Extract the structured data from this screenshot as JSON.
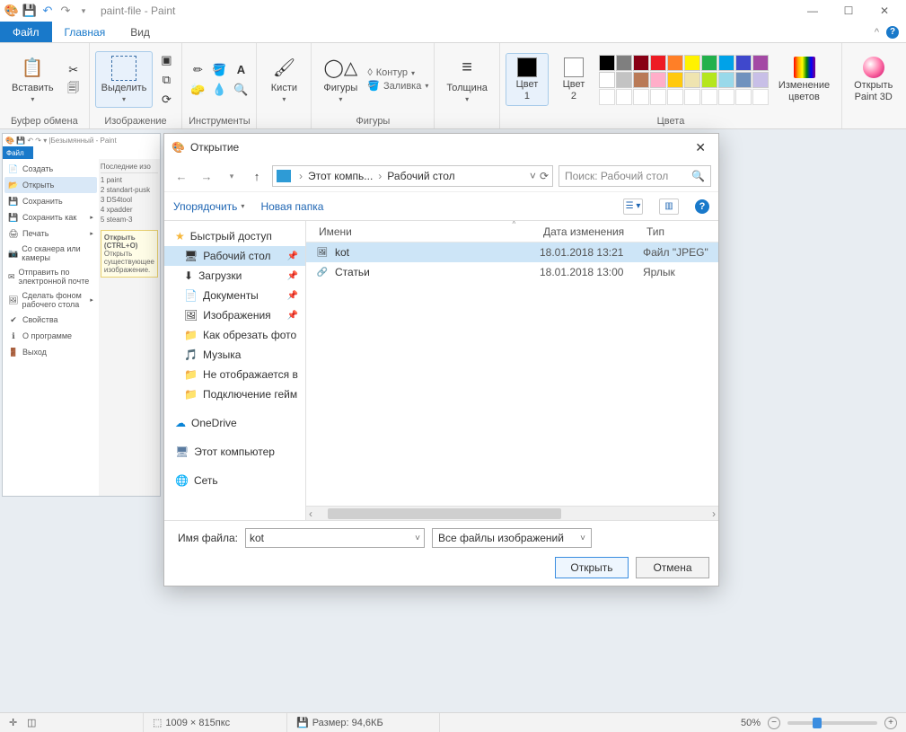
{
  "title": "paint-file - Paint",
  "tabs": {
    "file": "Файл",
    "home": "Главная",
    "view": "Вид"
  },
  "ribbon": {
    "clipboard": {
      "paste": "Вставить",
      "label": "Буфер обмена"
    },
    "image": {
      "select": "Выделить",
      "label": "Изображение"
    },
    "tools": {
      "label": "Инструменты"
    },
    "brushes": {
      "label": "Кисти"
    },
    "shapes": {
      "title": "Фигуры",
      "outline": "Контур",
      "fill": "Заливка",
      "label": "Фигуры"
    },
    "size": {
      "label": "Толщина"
    },
    "color1": "Цвет\n1",
    "color2": "Цвет\n2",
    "colors_label": "Цвета",
    "edit_colors": "Изменение\nцветов",
    "paint3d": "Открыть\nPaint 3D"
  },
  "palette": [
    "#000000",
    "#7f7f7f",
    "#880015",
    "#ed1c24",
    "#ff7f27",
    "#fff200",
    "#22b14c",
    "#00a2e8",
    "#3f48cc",
    "#a349a4",
    "#ffffff",
    "#c3c3c3",
    "#b97a57",
    "#ffaec9",
    "#ffc90e",
    "#efe4b0",
    "#b5e61d",
    "#99d9ea",
    "#7092be",
    "#c8bfe7"
  ],
  "subpaint": {
    "title": "Безымянный - Paint",
    "filetab": "Файл",
    "recent_header": "Последние изо",
    "recent": [
      "1 paint",
      "2 standart-pusk",
      "3 DS4tool",
      "4 xpadder",
      "5 steam-3"
    ],
    "tooltip_title": "Открыть (CTRL+O)",
    "tooltip_body": "Открыть существующее изображение.",
    "menu": [
      {
        "icon": "📄",
        "label": "Создать"
      },
      {
        "icon": "📂",
        "label": "Открыть"
      },
      {
        "icon": "💾",
        "label": "Сохранить"
      },
      {
        "icon": "💾",
        "label": "Сохранить как",
        "arrow": true
      },
      {
        "icon": "🖨",
        "label": "Печать",
        "arrow": true
      },
      {
        "icon": "📷",
        "label": "Со сканера или камеры"
      },
      {
        "icon": "✉",
        "label": "Отправить по электронной почте"
      },
      {
        "icon": "🖼",
        "label": "Сделать фоном рабочего стола",
        "arrow": true
      },
      {
        "icon": "✔",
        "label": "Свойства"
      },
      {
        "icon": "ℹ",
        "label": "О программе"
      },
      {
        "icon": "🚪",
        "label": "Выход"
      }
    ]
  },
  "dialog": {
    "title": "Открытие",
    "breadcrumb": [
      "Этот компь...",
      "Рабочий стол"
    ],
    "search_placeholder": "Поиск: Рабочий стол",
    "organize": "Упорядочить",
    "new_folder": "Новая папка",
    "columns": {
      "name": "Имени",
      "date": "Дата изменения",
      "type": "Тип"
    },
    "nav": {
      "quick": "Быстрый доступ",
      "items": [
        {
          "icon": "🖥",
          "label": "Рабочий стол",
          "pin": true,
          "sel": true
        },
        {
          "icon": "⬇",
          "label": "Загрузки",
          "pin": true
        },
        {
          "icon": "📄",
          "label": "Документы",
          "pin": true
        },
        {
          "icon": "🖼",
          "label": "Изображения",
          "pin": true
        },
        {
          "icon": "📁",
          "label": "Как обрезать фото"
        },
        {
          "icon": "🎵",
          "label": "Музыка"
        },
        {
          "icon": "📁",
          "label": "Не отображается в"
        },
        {
          "icon": "📁",
          "label": "Подключение гейм"
        }
      ],
      "onedrive": "OneDrive",
      "thispc": "Этот компьютер",
      "network": "Сеть"
    },
    "files": [
      {
        "icon": "🖼",
        "name": "kot",
        "date": "18.01.2018 13:21",
        "type": "Файл \"JPEG\"",
        "sel": true
      },
      {
        "icon": "🔗",
        "name": "Статьи",
        "date": "18.01.2018 13:00",
        "type": "Ярлык"
      }
    ],
    "filename_label": "Имя файла:",
    "filename_value": "kot",
    "filter": "Все файлы изображений",
    "open_btn": "Открыть",
    "cancel_btn": "Отмена"
  },
  "statusbar": {
    "dims": "1009 × 815пкс",
    "size": "Размер: 94,6КБ",
    "zoom": "50%"
  }
}
